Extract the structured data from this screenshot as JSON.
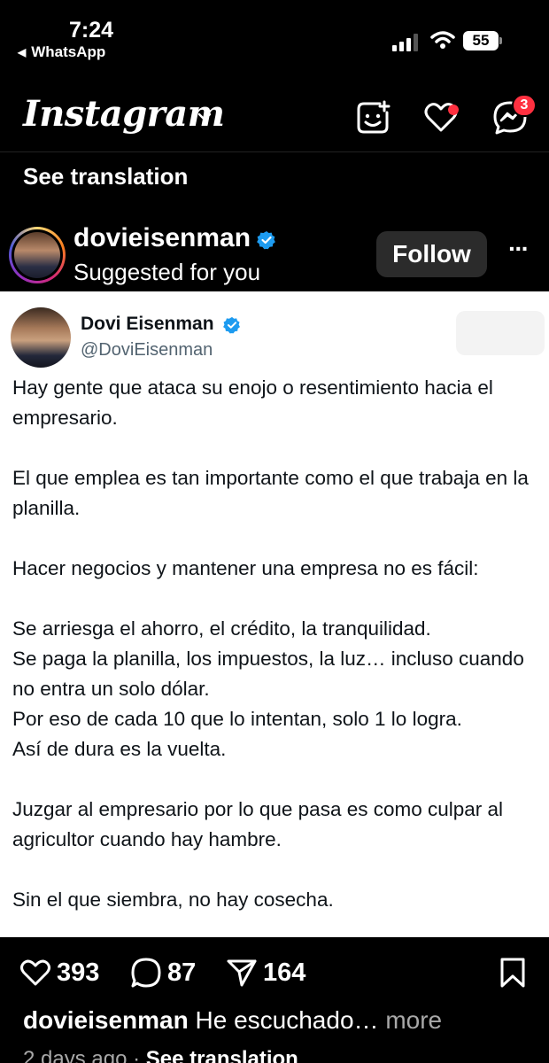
{
  "status_bar": {
    "time": "7:24",
    "back_app": "WhatsApp",
    "battery": "55"
  },
  "header": {
    "logo": "Instagram",
    "messages_badge": "3",
    "icons": [
      "chevron-down-icon",
      "add-icon",
      "heart-icon",
      "messenger-icon"
    ],
    "notification_color": "#ff3040"
  },
  "top_translation": "See translation",
  "post": {
    "username": "dovieisenman",
    "subtitle": "Suggested for you",
    "follow_label": "Follow",
    "more_label": "···",
    "verified_color": "#1d9bf0"
  },
  "tweet": {
    "name": "Dovi Eisenman",
    "handle": "@DoviEisenman",
    "paragraphs": [
      "Hay gente que ataca su enojo o resentimiento hacia el empresario.",
      "El que emplea es tan importante como el que trabaja en la planilla.",
      "Hacer negocios y mantener una empresa no es fácil:",
      "Se arriesga el ahorro, el crédito, la tranquilidad.\nSe paga la planilla, los impuestos, la luz… incluso cuando no entra un solo dólar.\nPor eso de  cada 10 que lo intentan, solo 1 lo logra.\nAsí de dura es la vuelta.",
      "Juzgar al empresario por lo que pasa es como culpar al agricultor cuando hay hambre.",
      "Sin el que siembra, no hay cosecha."
    ]
  },
  "actions": {
    "likes": "393",
    "comments": "87",
    "shares": "164"
  },
  "caption": {
    "user": "dovieisenman",
    "text": "He escuchado…",
    "more": "more"
  },
  "meta": {
    "time": "2 days ago",
    "separator": "·",
    "translate": "See translation"
  }
}
